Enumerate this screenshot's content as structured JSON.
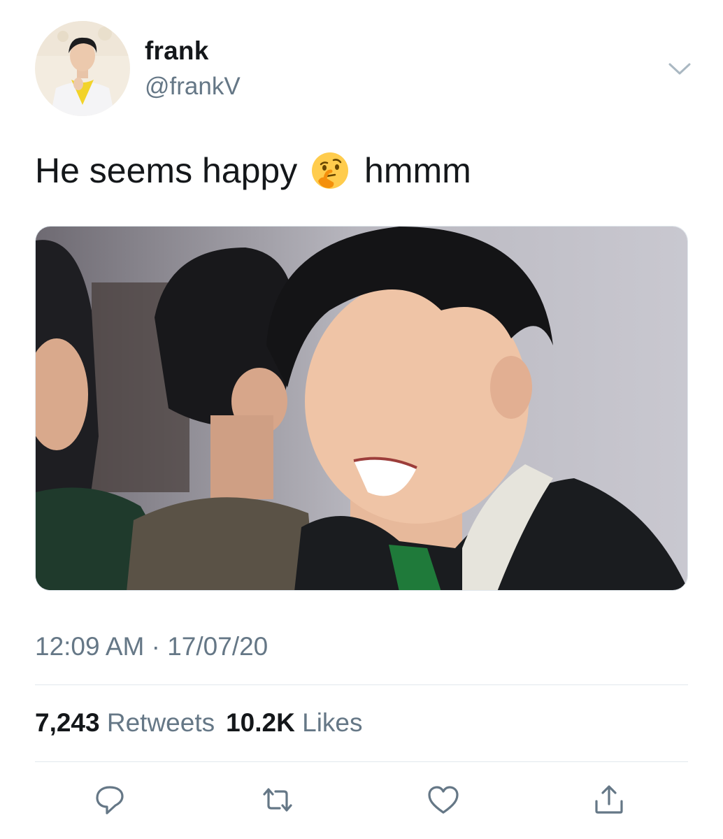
{
  "tweet": {
    "author_name": "frank",
    "author_handle": "@frankV",
    "text_before_emoji": "He seems happy",
    "text_after_emoji": "hmmm",
    "emoji": "thinking-face-emoji",
    "time": "12:09 AM",
    "separator": "·",
    "date": "17/07/20",
    "retweet_count": "7,243",
    "retweet_label": "Retweets",
    "like_count": "10.2K",
    "like_label": "Likes"
  },
  "actions": [
    {
      "name": "reply-icon"
    },
    {
      "name": "retweet-icon"
    },
    {
      "name": "like-icon"
    },
    {
      "name": "share-icon"
    }
  ],
  "colors": {
    "text_primary": "#14171a",
    "text_secondary": "#657786",
    "divider": "#e1e8ed",
    "icon": "#657786"
  }
}
